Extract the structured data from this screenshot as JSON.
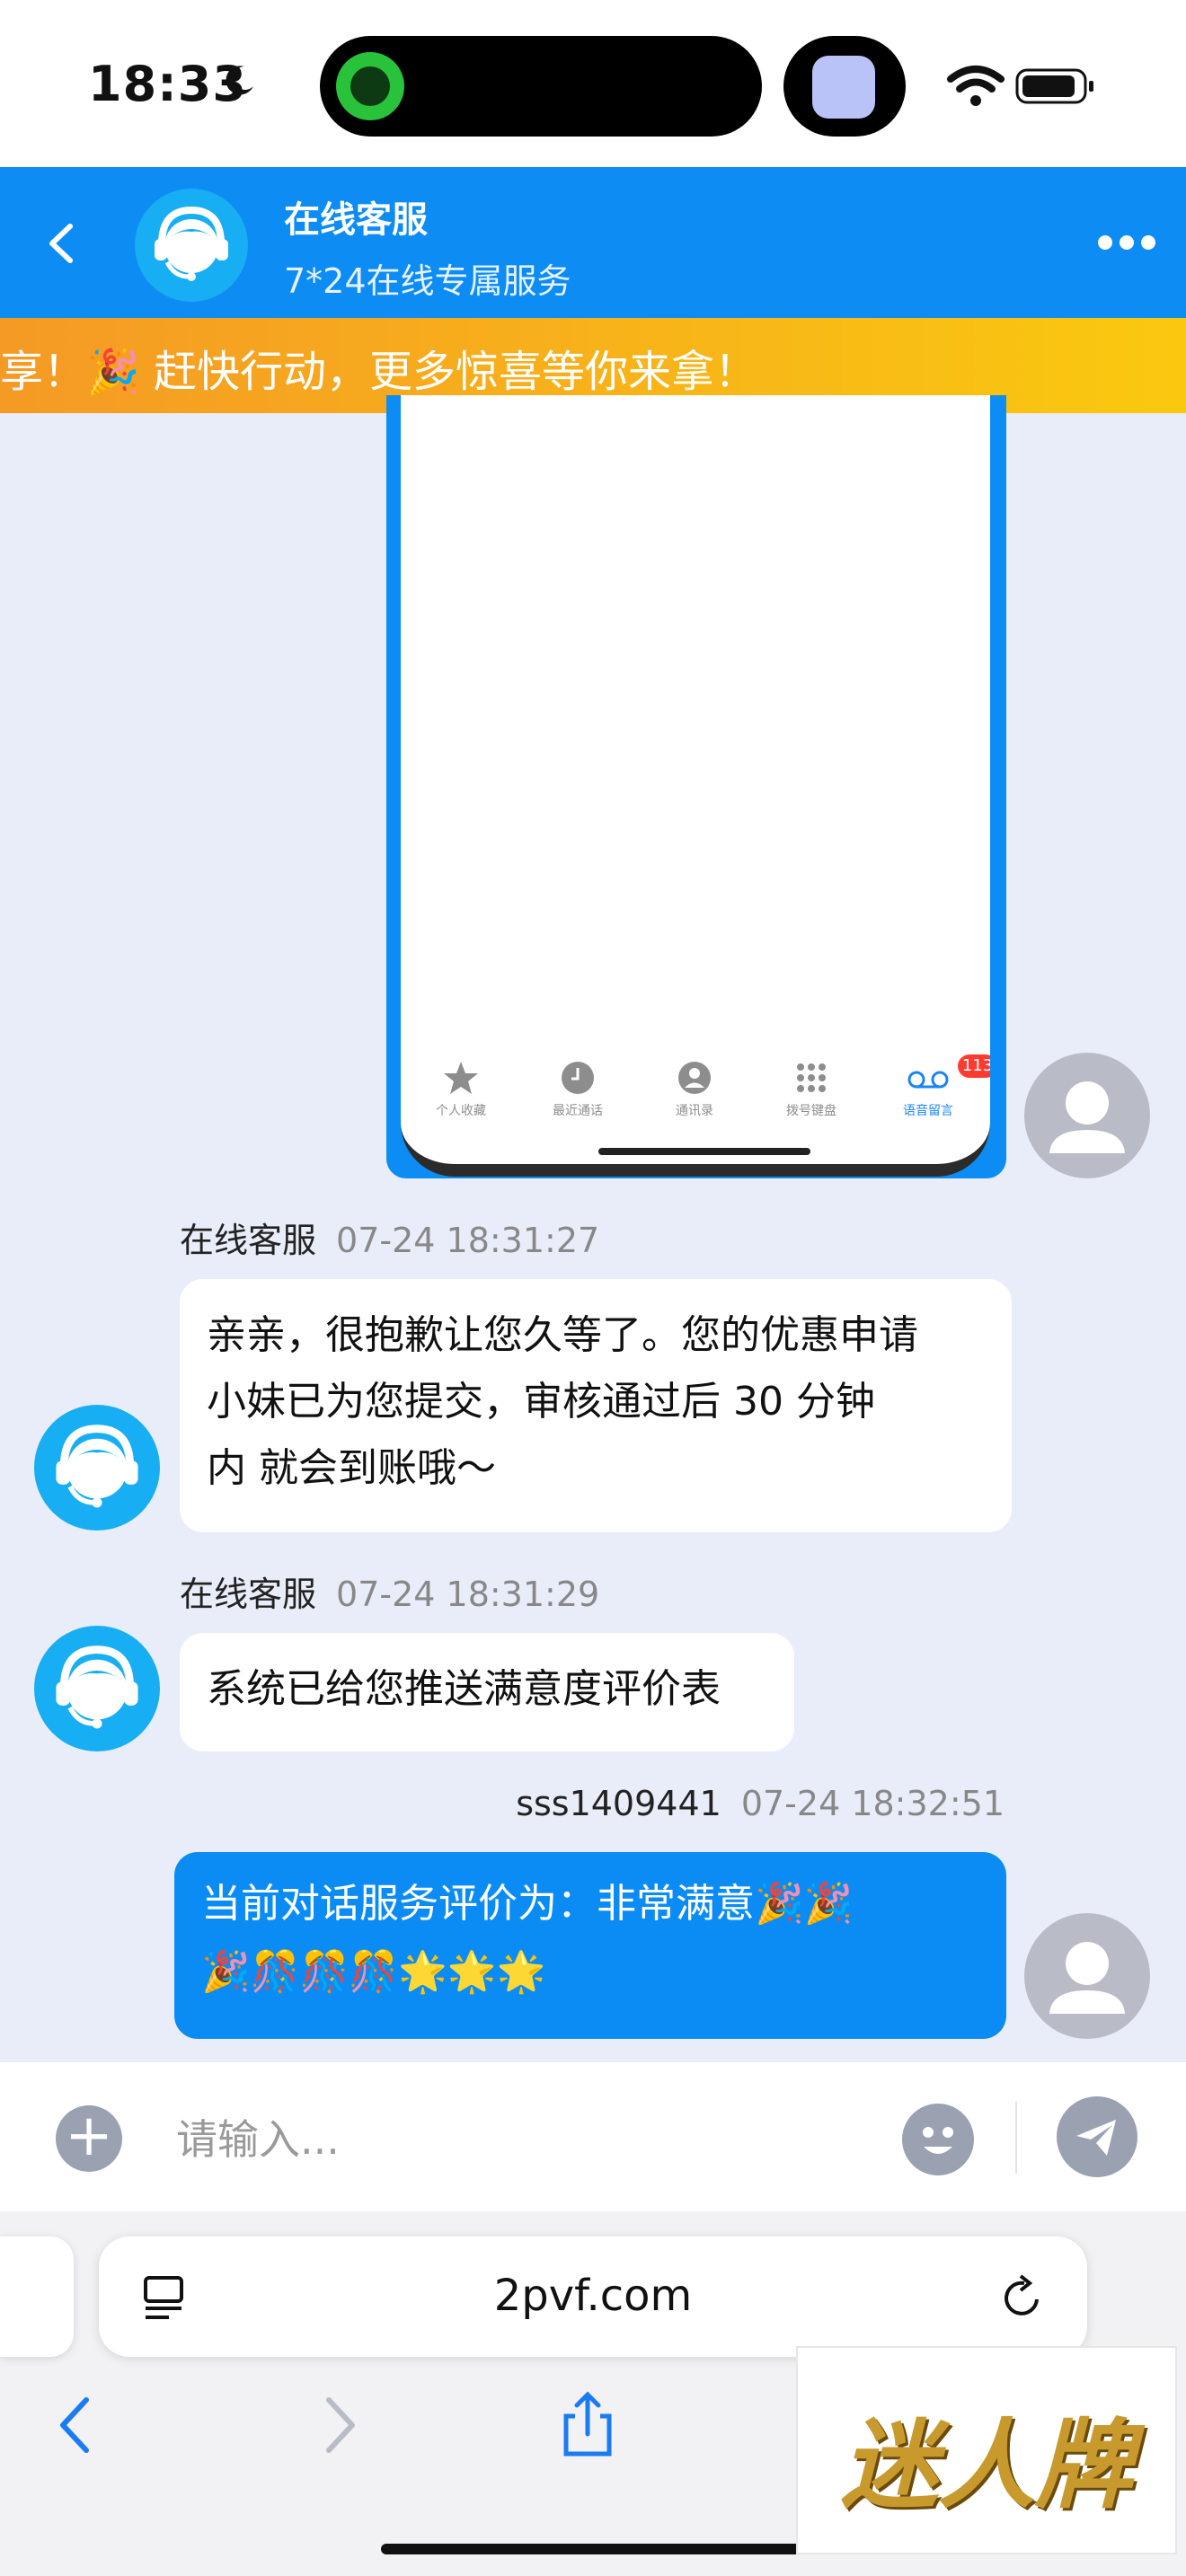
{
  "status_bar": {
    "time": "18:33"
  },
  "header": {
    "title": "在线客服",
    "subtitle": "7*24在线专属服务"
  },
  "banner": {
    "text": "享！🎉 赶快行动，更多惊喜等你来拿！"
  },
  "screenshot_tabs": [
    {
      "label": "个人收藏"
    },
    {
      "label": "最近通话"
    },
    {
      "label": "通讯录"
    },
    {
      "label": "拨号键盘"
    },
    {
      "label": "语音留言"
    }
  ],
  "screenshot_badge": "113",
  "messages": [
    {
      "sender": "在线客服",
      "time": "07-24 18:31:27",
      "lines": [
        "亲亲，很抱歉让您久等了。您的优惠申请",
        "小妹已为您提交，审核通过后 30 分钟",
        "内 就会到账哦～"
      ]
    },
    {
      "sender": "在线客服",
      "time": "07-24 18:31:29",
      "lines": [
        "系统已给您推送满意度评价表"
      ]
    },
    {
      "sender": "sss1409441",
      "time": "07-24 18:32:51",
      "lines": [
        "当前对话服务评价为：非常满意🎉🎉",
        "🎉🎊🎊🎊🌟🌟🌟"
      ]
    }
  ],
  "input": {
    "placeholder": "请输入..."
  },
  "browser": {
    "url": "2pvf.com"
  },
  "watermark": {
    "text": "迷人牌"
  },
  "colors": {
    "header_blue": "#0d8cf4",
    "banner_orange": "#f59a25",
    "banner_yellow": "#fac90f",
    "my_bubble": "#0b8cf5"
  }
}
